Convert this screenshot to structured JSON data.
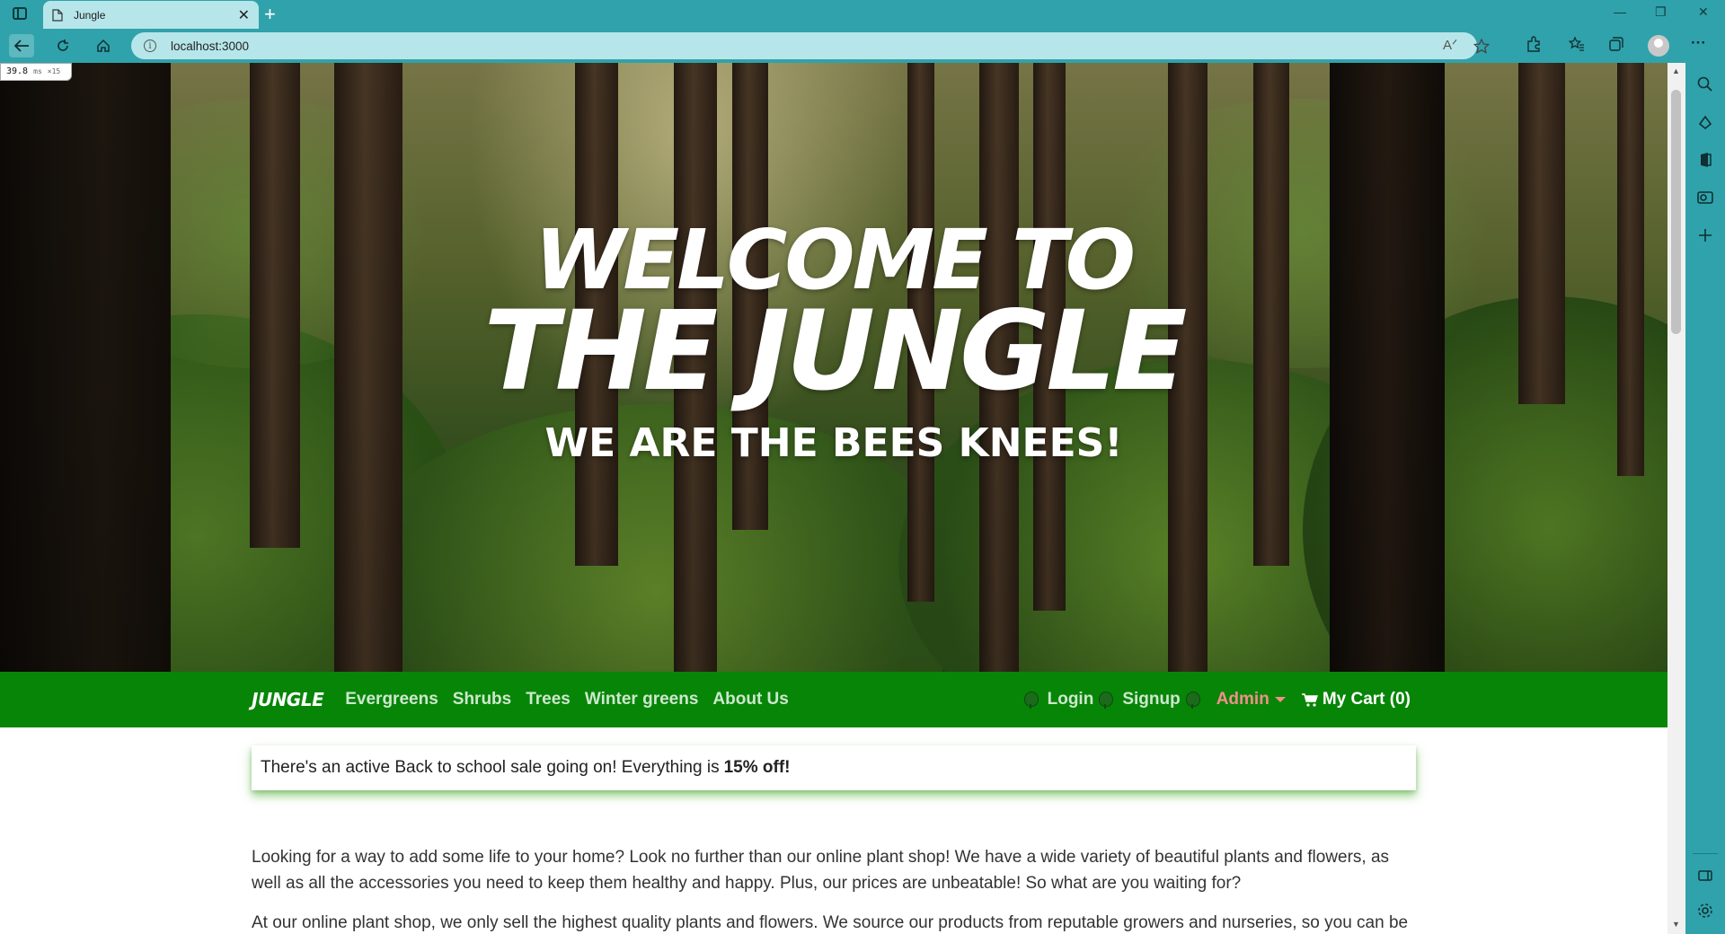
{
  "browser": {
    "tab_title": "Jungle",
    "tab_close": "✕",
    "new_tab": "+",
    "url": "localhost:3000",
    "window_controls": [
      "—",
      "❐",
      "✕"
    ],
    "more_menu": "···"
  },
  "perf_badge": {
    "time": "39.8",
    "unit": "ms",
    "extra": "×15"
  },
  "hero": {
    "line1": "WELCOME TO",
    "line2": "THE JUNGLE",
    "line3": "WE ARE THE BEES KNEES!"
  },
  "nav": {
    "brand": "JUNGLE",
    "links": [
      "Evergreens",
      "Shrubs",
      "Trees",
      "Winter greens",
      "About Us"
    ],
    "login": "Login",
    "signup": "Signup",
    "admin": "Admin",
    "cart": "My Cart (0)"
  },
  "sale": {
    "text": "There's an active Back to school sale going on! Everything is",
    "discount": "15% off!"
  },
  "about": {
    "p1": "Looking for a way to add some life to your home? Look no further than our online plant shop! We have a wide variety of beautiful plants and flowers, as well as all the accessories you need to keep them healthy and happy. Plus, our prices are unbeatable! So what are you waiting for?",
    "p2": "At our online plant shop, we only sell the highest quality plants and flowers. We source our products from reputable growers and nurseries, so you can be"
  },
  "colors": {
    "browser_teal": "#30a2ab",
    "navbar_green": "#078507",
    "admin_pink": "#f1908a"
  }
}
